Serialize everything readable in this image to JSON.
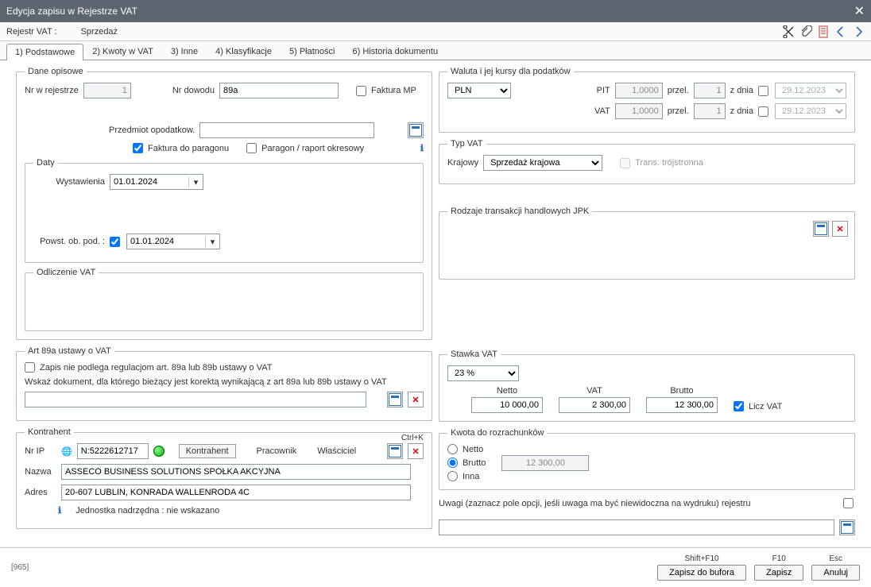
{
  "window": {
    "title": "Edycja zapisu w Rejestrze VAT"
  },
  "topbar": {
    "label": "Rejestr VAT :",
    "type": "Sprzedaż"
  },
  "tabs": [
    "1) Podstawowe",
    "2) Kwoty w VAT",
    "3) Inne",
    "4) Klasyfikacje",
    "5) Płatności",
    "6) Historia dokumentu"
  ],
  "opis": {
    "legend": "Dane opisowe",
    "nr_rej_label": "Nr w rejestrze",
    "nr_rej_value": "1",
    "nr_dow_label": "Nr dowodu",
    "nr_dow_value": "89a",
    "faktura_mp": "Faktura MP",
    "przedmiot_label": "Przedmiot opodatkow.",
    "przedmiot_value": "",
    "faktura_paragon": "Faktura do paragonu",
    "paragon_raport": "Paragon / raport okresowy"
  },
  "daty": {
    "legend": "Daty",
    "wyst_label": "Wystawienia",
    "wyst_value": "01.01.2024",
    "powst_label": "Powst. ob. pod. :",
    "powst_value": "01.01.2024"
  },
  "odliczenie": {
    "legend": "Odliczenie VAT"
  },
  "art89": {
    "legend": "Art 89a ustawy o VAT",
    "chk_label": "Zapis nie podlega regulacjom art. 89a lub 89b ustawy o VAT",
    "instr": "Wskaż dokument, dla którego bieżący jest korektą wynikającą z art 89a lub 89b ustawy o VAT",
    "value": ""
  },
  "kontrahent": {
    "legend": "Kontrahent",
    "shortcut": "Ctrl+K",
    "nrip_label": "Nr IP",
    "nrip_value": "N:5222612717",
    "link_k": "Kontrahent",
    "link_p": "Pracownik",
    "link_w": "Właściciel",
    "nazwa_label": "Nazwa",
    "nazwa_value": "ASSECO BUSINESS SOLUTIONS SPÓŁKA AKCYJNA",
    "adres_label": "Adres",
    "adres_value": "20-607 LUBLIN, KONRADA WALLENRODA 4C",
    "info": "Jednostka nadrzędna : nie wskazano"
  },
  "waluta": {
    "legend": "Waluta i jej kursy dla podatków",
    "currency": "PLN",
    "pit_label": "PIT",
    "pit_rate": "1,0000",
    "pit_przel": "przel.",
    "pit_przel_v": "1",
    "pit_zdnia": "z dnia",
    "pit_date": "29.12.2023",
    "vat_label": "VAT",
    "vat_rate": "1,0000",
    "vat_przel": "przel.",
    "vat_przel_v": "1",
    "vat_zdnia": "z dnia",
    "vat_date": "29.12.2023"
  },
  "typvat": {
    "legend": "Typ VAT",
    "krajowy_label": "Krajowy",
    "krajowy_value": "Sprzedaż krajowa",
    "trans_label": "Trans. trójstronna"
  },
  "rodzaje": {
    "legend": "Rodzaje transakcji handlowych JPK"
  },
  "stawka": {
    "legend": "Stawka VAT",
    "rate": "23 %",
    "netto_h": "Netto",
    "netto_v": "10 000,00",
    "vat_h": "VAT",
    "vat_v": "2 300,00",
    "brutto_h": "Brutto",
    "brutto_v": "12 300,00",
    "licz": "Licz VAT"
  },
  "kwota": {
    "legend": "Kwota do rozrachunków",
    "netto": "Netto",
    "brutto": "Brutto",
    "inna": "Inna",
    "value": "12 300,00"
  },
  "uwagi": {
    "label": "Uwagi  (zaznacz pole opcji, jeśli uwaga ma być niewidoczna na wydruku) rejestru",
    "value": ""
  },
  "footer": {
    "left": "[965]",
    "b1_sc": "Shift+F10",
    "b1": "Zapisz do bufora",
    "b2_sc": "F10",
    "b2": "Zapisz",
    "b3_sc": "Esc",
    "b3": "Anuluj"
  }
}
